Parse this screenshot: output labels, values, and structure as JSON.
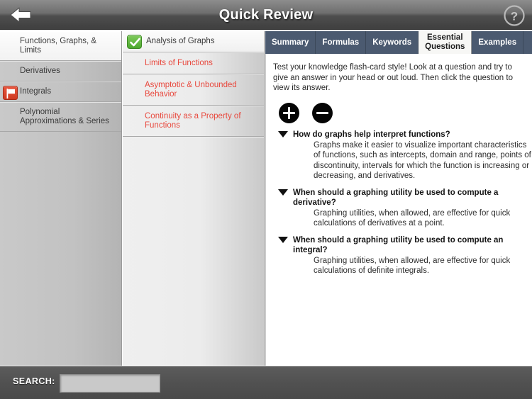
{
  "header": {
    "title": "Quick Review",
    "back_icon": "back-arrow-icon",
    "help_icon": "question-mark-help-icon"
  },
  "column1": {
    "items": [
      {
        "label": "Functions, Graphs, & Limits",
        "selected": true,
        "icon": ""
      },
      {
        "label": "Derivatives",
        "selected": false,
        "icon": ""
      },
      {
        "label": "Integrals",
        "selected": false,
        "icon": "red-flag-icon"
      },
      {
        "label": "Polynomial Approximations & Series",
        "selected": false,
        "icon": ""
      }
    ]
  },
  "column2": {
    "header": {
      "label": "Analysis of Graphs",
      "icon": "green-check-icon"
    },
    "items": [
      {
        "label": "Limits of Functions"
      },
      {
        "label": "Asymptotic & Unbounded Behavior"
      },
      {
        "label": "Continuity as a Property of Functions"
      }
    ]
  },
  "tabs": [
    {
      "label": "Summary",
      "active": false
    },
    {
      "label": "Formulas",
      "active": false
    },
    {
      "label": "Keywords",
      "active": false
    },
    {
      "label": "Essential\nQuestions",
      "line1": "Essential",
      "line2": "Questions",
      "active": true
    },
    {
      "label": "Examples",
      "active": false
    }
  ],
  "content": {
    "intro": "Test your knowledge flash-card style! Look at a question and try to give an answer in your head or out loud. Then click the question to view its answer.",
    "expand_all_label": "+",
    "collapse_all_label": "−",
    "items": [
      {
        "question": "How do graphs help interpret functions?",
        "answer": "Graphs make it easier to visualize important characteristics of functions, such as intercepts, domain and range, points of discontinuity, intervals for which the function is increasing or decreasing, and derivatives."
      },
      {
        "question": "When should a graphing utility be used to compute a derivative?",
        "answer": "Graphing utilities, when allowed, are effective for quick calculations of derivatives at a point."
      },
      {
        "question": "When should a graphing utility be used to compute an integral?",
        "answer": "Graphing utilities, when allowed, are effective for quick calculations of definite integrals."
      }
    ]
  },
  "search": {
    "label": "SEARCH:",
    "value": "",
    "placeholder": ""
  },
  "colors": {
    "topbar_dark": "#3f3f3f",
    "tabbar_blue": "#4b5a70",
    "link_red": "#e8483d",
    "flag_red": "#cf3a22",
    "check_green": "#4da82f",
    "searchbar_gray": "#515151"
  }
}
